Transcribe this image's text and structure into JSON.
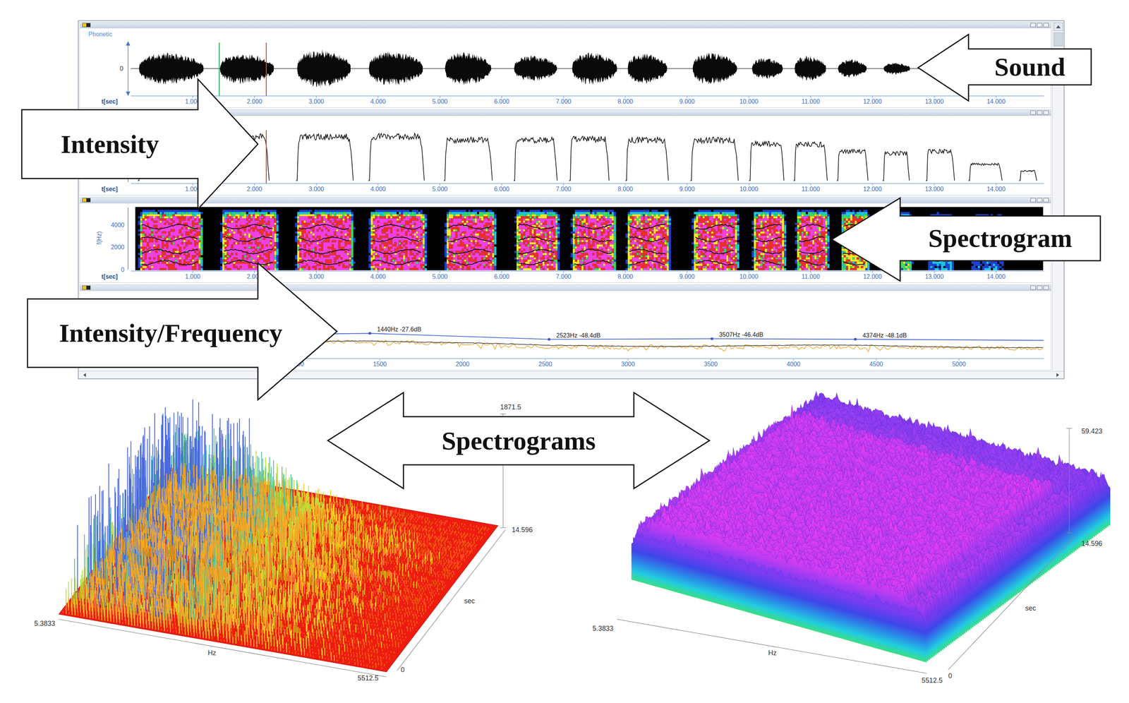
{
  "callouts": [
    {
      "label": "Sound",
      "direction": "left"
    },
    {
      "label": "Intensity",
      "direction": "right"
    },
    {
      "label": "Spectrogram",
      "direction": "left"
    },
    {
      "label": "Intensity/Frequency",
      "direction": "right"
    },
    {
      "label": "Spectrograms",
      "direction": "both"
    }
  ],
  "time_axis": {
    "label": "t[sec]",
    "ticks": [
      "1.000",
      "2.000",
      "3.000",
      "4.000",
      "5.000",
      "6.000",
      "7.000",
      "8.000",
      "9.000",
      "10.000",
      "11.000",
      "12.000",
      "13.000",
      "14.000"
    ]
  },
  "cursors": [
    {
      "time": 1.43,
      "color": "#2fa84f"
    },
    {
      "time": 2.19,
      "color": "#e0403a"
    }
  ],
  "sound_panel": {
    "label": "Phonetic",
    "zero": "0",
    "segments": [
      {
        "start": 0.13,
        "end": 1.18,
        "amplitude": 0.75
      },
      {
        "start": 1.44,
        "end": 2.32,
        "amplitude": 0.72
      },
      {
        "start": 2.69,
        "end": 3.56,
        "amplitude": 0.9
      },
      {
        "start": 3.85,
        "end": 4.73,
        "amplitude": 0.8
      },
      {
        "start": 5.08,
        "end": 5.83,
        "amplitude": 0.78
      },
      {
        "start": 6.2,
        "end": 6.9,
        "amplitude": 0.6
      },
      {
        "start": 7.14,
        "end": 7.87,
        "amplitude": 0.75
      },
      {
        "start": 8.04,
        "end": 8.68,
        "amplitude": 0.72
      },
      {
        "start": 9.09,
        "end": 9.81,
        "amplitude": 0.75
      },
      {
        "start": 10.05,
        "end": 10.55,
        "amplitude": 0.5
      },
      {
        "start": 10.74,
        "end": 11.25,
        "amplitude": 0.6
      },
      {
        "start": 11.44,
        "end": 11.91,
        "amplitude": 0.42
      },
      {
        "start": 12.18,
        "end": 12.61,
        "amplitude": 0.28
      }
    ]
  },
  "intensity_panel": {
    "segments": [
      {
        "start": 0.13,
        "end": 1.23,
        "level": 0.9
      },
      {
        "start": 1.41,
        "end": 2.22,
        "level": 0.97
      },
      {
        "start": 2.69,
        "end": 3.58,
        "level": 0.96
      },
      {
        "start": 3.86,
        "end": 4.73,
        "level": 0.97
      },
      {
        "start": 5.08,
        "end": 5.83,
        "level": 0.89
      },
      {
        "start": 6.21,
        "end": 6.88,
        "level": 0.89
      },
      {
        "start": 7.11,
        "end": 7.72,
        "level": 0.91
      },
      {
        "start": 8.02,
        "end": 8.68,
        "level": 0.89
      },
      {
        "start": 9.07,
        "end": 9.81,
        "level": 0.89
      },
      {
        "start": 10.02,
        "end": 10.55,
        "level": 0.81
      },
      {
        "start": 10.74,
        "end": 11.25,
        "level": 0.79
      },
      {
        "start": 11.44,
        "end": 11.91,
        "level": 0.64
      },
      {
        "start": 12.18,
        "end": 12.58,
        "level": 0.6
      },
      {
        "start": 12.88,
        "end": 13.31,
        "level": 0.64
      },
      {
        "start": 13.57,
        "end": 14.08,
        "level": 0.36
      },
      {
        "start": 14.39,
        "end": 14.64,
        "level": 0.21
      }
    ]
  },
  "spectrogram_panel": {
    "axis_label": "f(Hz)",
    "ticks": [
      "4000",
      "2000",
      "0"
    ],
    "segments": [
      {
        "start": 0.15,
        "end": 1.12,
        "energy": 0.95
      },
      {
        "start": 1.48,
        "end": 2.33,
        "energy": 0.95
      },
      {
        "start": 2.69,
        "end": 3.56,
        "energy": 0.95
      },
      {
        "start": 3.88,
        "end": 4.73,
        "energy": 0.95
      },
      {
        "start": 5.11,
        "end": 5.86,
        "energy": 0.92
      },
      {
        "start": 6.24,
        "end": 6.88,
        "energy": 0.88
      },
      {
        "start": 7.15,
        "end": 7.81,
        "energy": 0.9
      },
      {
        "start": 8.04,
        "end": 8.68,
        "energy": 0.88
      },
      {
        "start": 9.11,
        "end": 9.79,
        "energy": 0.9
      },
      {
        "start": 10.08,
        "end": 10.55,
        "energy": 0.88
      },
      {
        "start": 10.78,
        "end": 11.25,
        "energy": 0.9
      },
      {
        "start": 11.5,
        "end": 11.91,
        "energy": 0.75
      },
      {
        "start": 12.18,
        "end": 12.61,
        "energy": 0.55
      },
      {
        "start": 12.9,
        "end": 13.3,
        "energy": 0.35
      },
      {
        "start": 13.6,
        "end": 14.1,
        "energy": 0.3
      }
    ]
  },
  "spectrum_panel": {
    "ticks": [
      "1000",
      "1500",
      "2000",
      "2500",
      "3000",
      "3500",
      "4000",
      "4500",
      "5000"
    ],
    "peaks": [
      {
        "hz": 1440,
        "db": -27.6,
        "label": "1440Hz -27.6dB"
      },
      {
        "hz": 2523,
        "db": -48.4,
        "label": "2523Hz -48.4dB"
      },
      {
        "hz": 3507,
        "db": -46.4,
        "label": "3507Hz -46.4dB"
      },
      {
        "hz": 4374,
        "db": -48.1,
        "label": "4374Hz -48.1dB"
      }
    ],
    "envelope": [
      {
        "hz": 0,
        "db": -36
      },
      {
        "hz": 700,
        "db": -33
      },
      {
        "hz": 1440,
        "db": -27.6
      },
      {
        "hz": 2523,
        "db": -48.4
      },
      {
        "hz": 3507,
        "db": -46.4
      },
      {
        "hz": 4374,
        "db": -48.1
      },
      {
        "hz": 5512,
        "db": -52
      }
    ]
  },
  "spectrogram_3d": [
    {
      "kind": "spikes",
      "z_max": "1871.5",
      "freq_min": "5.3833",
      "freq_max": "5512.5",
      "freq_label": "Hz",
      "time_min": "0",
      "time_max": "14.596",
      "time_label": "sec"
    },
    {
      "kind": "surface",
      "z_max": "59.423",
      "freq_min": "5.3833",
      "freq_max": "5512.5",
      "freq_label": "Hz",
      "time_min": "0",
      "time_max": "14.596",
      "time_label": "sec"
    }
  ]
}
